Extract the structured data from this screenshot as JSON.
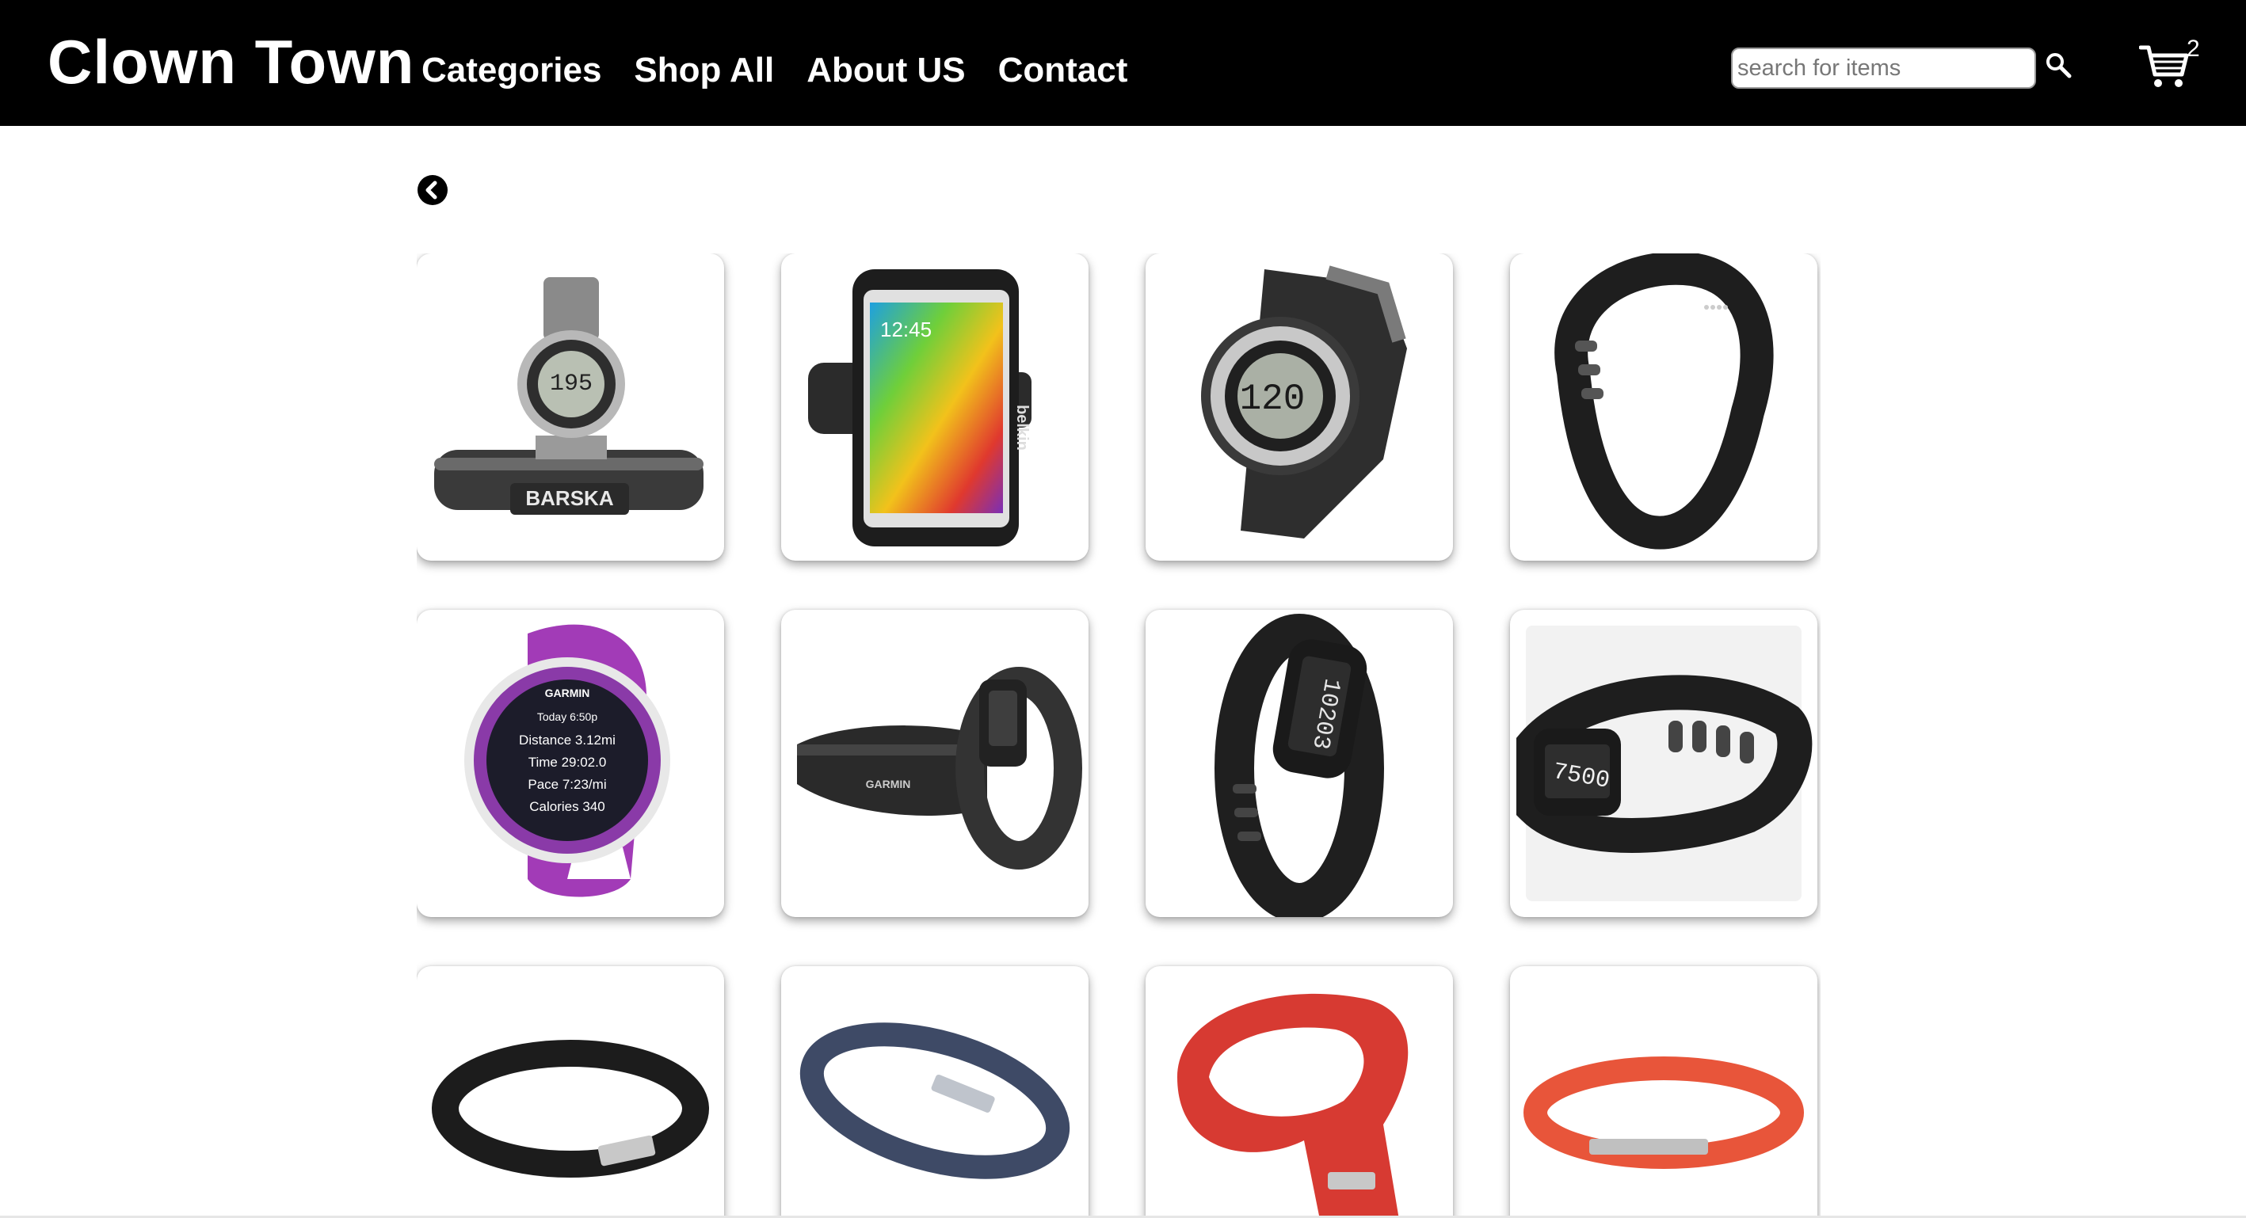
{
  "header": {
    "brand": "Clown Town",
    "nav": [
      {
        "label": "Categories"
      },
      {
        "label": "Shop All"
      },
      {
        "label": "About US"
      },
      {
        "label": "Contact"
      }
    ],
    "search": {
      "placeholder": "search for items",
      "value": ""
    },
    "cart": {
      "count": "2"
    }
  },
  "products": [
    {
      "name": "Barska heart rate monitor watch",
      "brand_text": "BARSKA"
    },
    {
      "name": "Belkin sport armband",
      "brand_text": "belkin",
      "screen_time": "12:45"
    },
    {
      "name": "Heart rate watch",
      "display": "120"
    },
    {
      "name": "Black fitness band"
    },
    {
      "name": "Garmin Forerunner watch",
      "brand_text": "GARMIN",
      "stats": [
        "Today 6:50p",
        "Distance 3.12mi",
        "Time 29:02.0",
        "Pace 7:23/mi",
        "Calories 340"
      ]
    },
    {
      "name": "Garmin vivofit with heart strap",
      "brand_text": "GARMIN"
    },
    {
      "name": "Garmin vivofit band",
      "display": "10203"
    },
    {
      "name": "Garmin vivofit band",
      "display": "7500"
    },
    {
      "name": "Jawbone UP black"
    },
    {
      "name": "Jawbone UP navy"
    },
    {
      "name": "Jawbone UP red"
    },
    {
      "name": "Jawbone UP24 orange"
    }
  ],
  "colors": {
    "header_bg": "#000000",
    "header_text": "#ffffff",
    "card_bg": "#ffffff",
    "accent_purple": "#a23bb7",
    "jawbone_red": "#d73a32",
    "jawbone_orange": "#e8553a",
    "jawbone_navy": "#3e4a66"
  },
  "icons": {
    "search": "search-icon",
    "cart": "cart-icon",
    "back": "chevron-left-circle-icon"
  }
}
